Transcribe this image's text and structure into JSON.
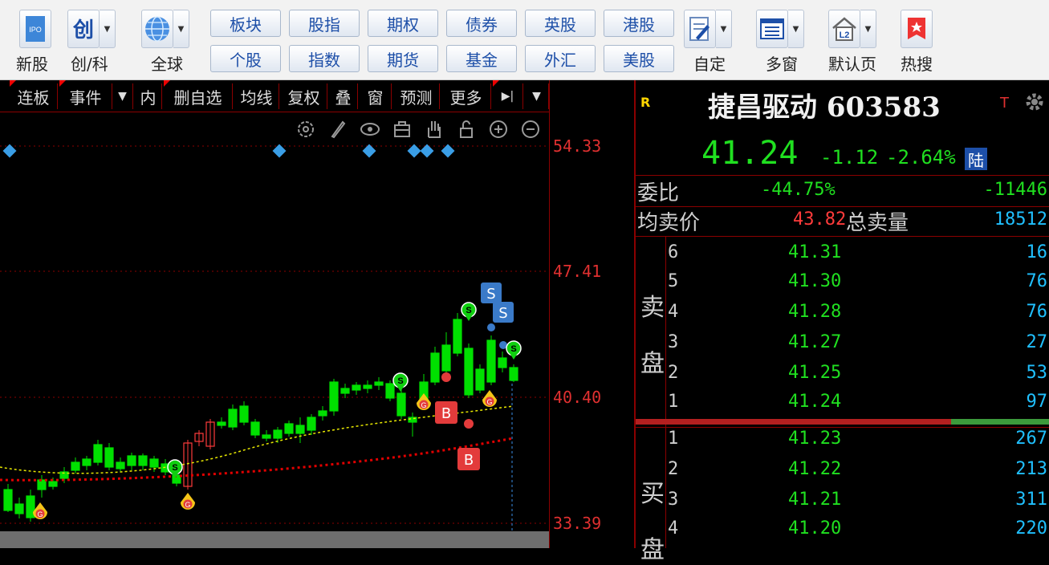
{
  "toolbar": {
    "ipo": {
      "icon": "ipo-icon",
      "label": "新股"
    },
    "chuang": {
      "icon": "chuang-icon",
      "label": "创/科"
    },
    "global": {
      "icon": "globe-icon",
      "label": "全球"
    },
    "buttons_top": [
      "板块",
      "股指",
      "期权",
      "债券",
      "英股",
      "港股"
    ],
    "buttons_bottom": [
      "个股",
      "指数",
      "期货",
      "基金",
      "外汇",
      "美股"
    ],
    "custom": {
      "icon": "edit-icon",
      "label": "自定"
    },
    "multi": {
      "icon": "multi-window-icon",
      "label": "多窗"
    },
    "default_page": {
      "icon": "l2-home-icon",
      "icon_text": "L2",
      "label": "默认页"
    },
    "hot": {
      "icon": "hot-search-icon",
      "label": "热搜"
    }
  },
  "subtabs": [
    "连板",
    "事件",
    "▼",
    "内",
    "删自选",
    "均线",
    "复权",
    "叠",
    "窗",
    "预测",
    "更多",
    "▶|",
    "▼"
  ],
  "chart": {
    "tool_icons": [
      "settings-icon",
      "pen-icon",
      "eye-icon",
      "toolbox-icon",
      "hand-icon",
      "lock-icon",
      "zoom-in-icon",
      "zoom-out-icon"
    ],
    "y_ticks": [
      "54.33",
      "47.41",
      "40.40",
      "33.39"
    ],
    "markers": {
      "sell": "S",
      "buy": "B",
      "gold": "G",
      "signal": "S"
    },
    "colors": {
      "up": "#ff3b3b",
      "down": "#00e000",
      "ma_yellow": "#e8e800",
      "ma_red": "#e00000",
      "grid": "#8b0000"
    }
  },
  "quote": {
    "r_badge": "R",
    "title": "捷昌驱动 603583",
    "t_badge": "T",
    "price": "41.24",
    "change": "-1.12",
    "change_pct": "-2.64%",
    "market": "陆",
    "weibi_label": "委比",
    "weibi_value": "-44.75%",
    "weicha_value": "-11446",
    "avg_sell_label": "均卖价",
    "avg_sell_value": "43.82",
    "total_sell_label": "总卖量",
    "total_sell_value": "18512",
    "sell_label_1": "卖",
    "sell_label_2": "盘",
    "buy_label_1": "买",
    "buy_label_2": "盘",
    "sell": [
      {
        "level": "6",
        "price": "41.31",
        "vol": "16"
      },
      {
        "level": "5",
        "price": "41.30",
        "vol": "76"
      },
      {
        "level": "4",
        "price": "41.28",
        "vol": "76"
      },
      {
        "level": "3",
        "price": "41.27",
        "vol": "27"
      },
      {
        "level": "2",
        "price": "41.25",
        "vol": "53"
      },
      {
        "level": "1",
        "price": "41.24",
        "vol": "97"
      }
    ],
    "buy": [
      {
        "level": "1",
        "price": "41.23",
        "vol": "267"
      },
      {
        "level": "2",
        "price": "41.22",
        "vol": "213"
      },
      {
        "level": "3",
        "price": "41.21",
        "vol": "311"
      },
      {
        "level": "4",
        "price": "41.20",
        "vol": "220"
      }
    ]
  }
}
